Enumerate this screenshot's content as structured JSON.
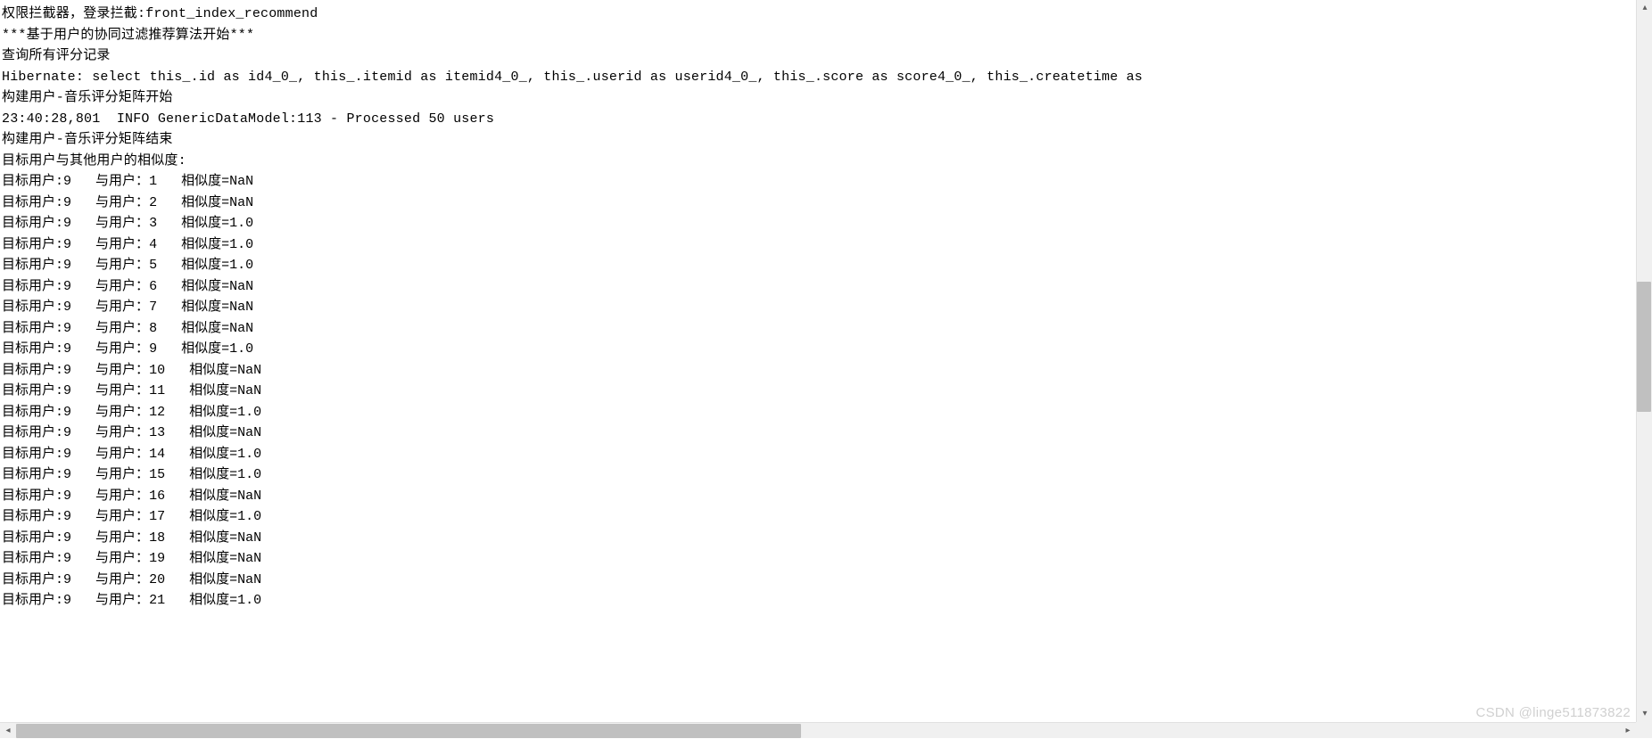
{
  "header_lines": [
    "权限拦截器，登录拦截:front_index_recommend",
    "***基于用户的协同过滤推荐算法开始***",
    "查询所有评分记录",
    "Hibernate: select this_.id as id4_0_, this_.itemid as itemid4_0_, this_.userid as userid4_0_, this_.score as score4_0_, this_.createtime as ",
    "构建用户-音乐评分矩阵开始",
    "23:40:28,801  INFO GenericDataModel:113 - Processed 50 users",
    "构建用户-音乐评分矩阵结束",
    "目标用户与其他用户的相似度:"
  ],
  "similarity": {
    "target_label": "目标用户:",
    "target_id": "9",
    "user_label": "与用户：",
    "value_label": "相似度=",
    "rows": [
      {
        "user": 1,
        "value": "NaN"
      },
      {
        "user": 2,
        "value": "NaN"
      },
      {
        "user": 3,
        "value": "1.0"
      },
      {
        "user": 4,
        "value": "1.0"
      },
      {
        "user": 5,
        "value": "1.0"
      },
      {
        "user": 6,
        "value": "NaN"
      },
      {
        "user": 7,
        "value": "NaN"
      },
      {
        "user": 8,
        "value": "NaN"
      },
      {
        "user": 9,
        "value": "1.0"
      },
      {
        "user": 10,
        "value": "NaN"
      },
      {
        "user": 11,
        "value": "NaN"
      },
      {
        "user": 12,
        "value": "1.0"
      },
      {
        "user": 13,
        "value": "NaN"
      },
      {
        "user": 14,
        "value": "1.0"
      },
      {
        "user": 15,
        "value": "1.0"
      },
      {
        "user": 16,
        "value": "NaN"
      },
      {
        "user": 17,
        "value": "1.0"
      },
      {
        "user": 18,
        "value": "NaN"
      },
      {
        "user": 19,
        "value": "NaN"
      },
      {
        "user": 20,
        "value": "NaN"
      },
      {
        "user": 21,
        "value": "1.0"
      }
    ]
  },
  "watermark": "CSDN @linge511873822"
}
